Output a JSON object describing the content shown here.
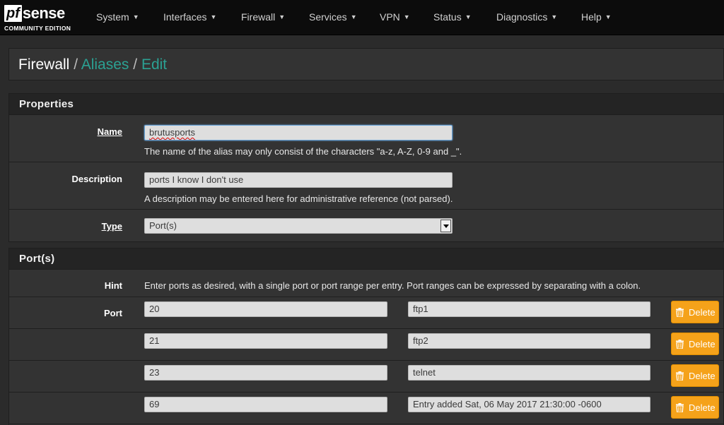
{
  "brand": {
    "logo_main_pf": "pf",
    "logo_main_sense": "sense",
    "logo_sub": "COMMUNITY EDITION"
  },
  "nav": {
    "items": [
      {
        "label": "System"
      },
      {
        "label": "Interfaces"
      },
      {
        "label": "Firewall"
      },
      {
        "label": "Services"
      },
      {
        "label": "VPN"
      },
      {
        "label": "Status"
      },
      {
        "label": "Diagnostics"
      },
      {
        "label": "Help"
      }
    ]
  },
  "breadcrumb": {
    "root": "Firewall",
    "aliases": "Aliases",
    "edit": "Edit",
    "sep": "/"
  },
  "properties": {
    "title": "Properties",
    "name_label": "Name",
    "name_value": "brutusports",
    "name_help": "The name of the alias may only consist of the characters \"a-z, A-Z, 0-9 and _\".",
    "description_label": "Description",
    "description_value": "ports I know I don't use",
    "description_help": "A description may be entered here for administrative reference (not parsed).",
    "type_label": "Type",
    "type_value": "Port(s)"
  },
  "ports": {
    "title": "Port(s)",
    "hint_label": "Hint",
    "hint_text": "Enter ports as desired, with a single port or port range per entry. Port ranges can be expressed by separating with a colon.",
    "port_label": "Port",
    "delete_label": "Delete",
    "entries": [
      {
        "port": "20",
        "desc": "ftp1"
      },
      {
        "port": "21",
        "desc": "ftp2"
      },
      {
        "port": "23",
        "desc": "telnet"
      },
      {
        "port": "69",
        "desc": "Entry added Sat, 06 May 2017 21:30:00 -0600"
      }
    ]
  },
  "colors": {
    "accent": "#2ba193",
    "delete_button": "#f5a21a",
    "navbar": "#0c0c0c"
  }
}
